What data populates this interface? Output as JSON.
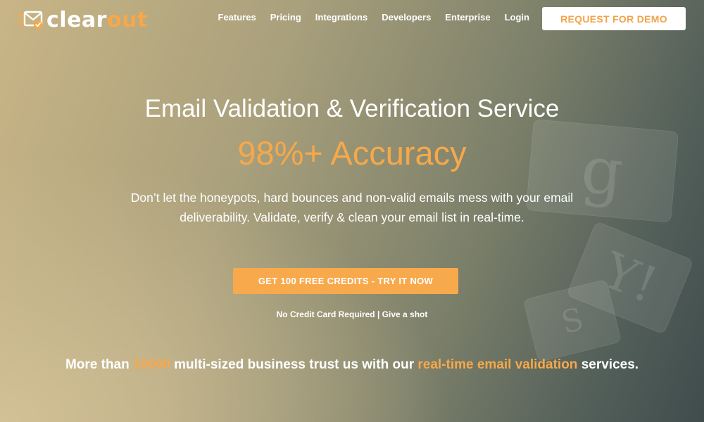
{
  "brand": {
    "part1": "clear",
    "part2": "out"
  },
  "nav": {
    "items": [
      {
        "label": "Features"
      },
      {
        "label": "Pricing"
      },
      {
        "label": "Integrations"
      },
      {
        "label": "Developers"
      },
      {
        "label": "Enterprise"
      },
      {
        "label": "Login"
      }
    ],
    "demo_label": "REQUEST FOR DEMO"
  },
  "hero": {
    "title": "Email Validation & Verification Service",
    "accuracy": "98%+ Accuracy",
    "description_line1": "Don’t let the honeypots, hard bounces and non-valid emails mess with your email",
    "description_line2": "deliverability. Validate, verify & clean your email list in real-time.",
    "cta_label": "GET 100 FREE CREDITS - TRY IT NOW",
    "note": "No Credit Card Required | Give a shot"
  },
  "trust": {
    "part1": "More than ",
    "count": "10000",
    "part2": " multi-sized business trust us with our ",
    "highlight": "real-time email validation",
    "part3": " services."
  },
  "decor": {
    "tile1": "g",
    "tile2": "Y!",
    "tile3": "S"
  },
  "colors": {
    "accent": "#f6a84a",
    "button": "#f7a94c",
    "demo_text": "#f2a349"
  }
}
